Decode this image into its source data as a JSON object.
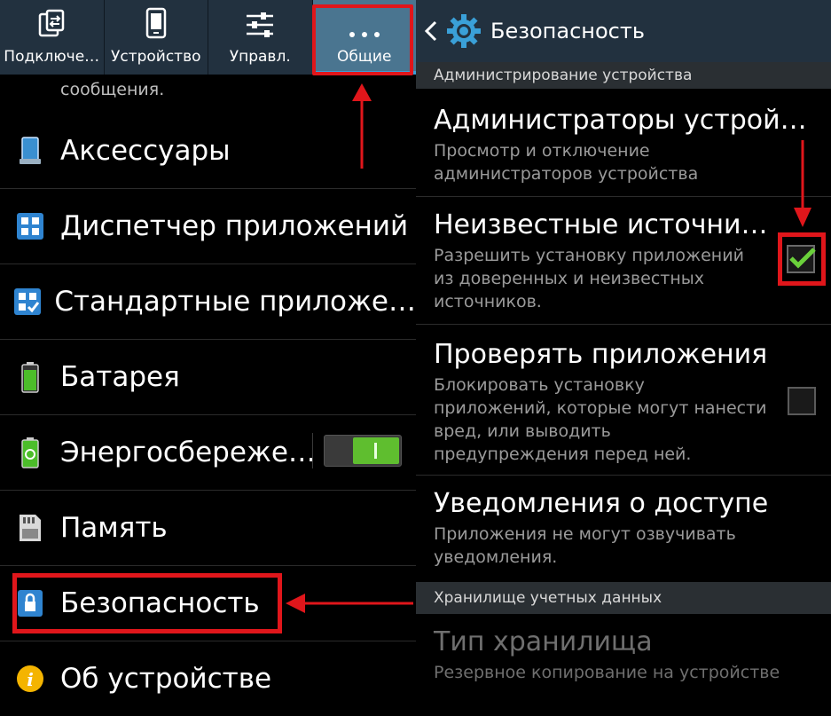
{
  "left": {
    "tabs": [
      {
        "label": "Подключе…",
        "icon": "connections-icon"
      },
      {
        "label": "Устройство",
        "icon": "device-icon"
      },
      {
        "label": "Управл.",
        "icon": "controls-icon"
      },
      {
        "label": "Общие",
        "icon": "more-icon",
        "active": true
      }
    ],
    "partial_text": "сообщения.",
    "items": [
      {
        "label": "Аксессуары",
        "icon": "accessories-icon"
      },
      {
        "label": "Диспетчер приложений",
        "icon": "app-manager-icon"
      },
      {
        "label": "Стандартные приложе…",
        "icon": "default-apps-icon"
      },
      {
        "label": "Батарея",
        "icon": "battery-icon"
      },
      {
        "label": "Энергосбереже…",
        "icon": "power-saving-icon",
        "toggle": true
      },
      {
        "label": "Память",
        "icon": "storage-icon"
      },
      {
        "label": "Безопасность",
        "icon": "security-lock-icon",
        "highlighted": true
      },
      {
        "label": "Об устройстве",
        "icon": "info-icon"
      }
    ]
  },
  "right": {
    "header_title": "Безопасность",
    "section1": "Администрирование устройства",
    "items": [
      {
        "title": "Администраторы устрой…",
        "subtitle_lines": [
          "Просмотр и отключение",
          "администраторов устройства"
        ]
      },
      {
        "title": "Неизвестные источни…",
        "subtitle_lines": [
          "Разрешить установку приложений",
          "из доверенных и неизвестных",
          "источников."
        ],
        "checked": true
      },
      {
        "title": "Проверять приложения",
        "subtitle_lines": [
          "Блокировать установку",
          "приложений, которые могут нанести",
          "вред, или выводить",
          "предупреждения перед ней."
        ],
        "checked": false
      },
      {
        "title": "Уведомления о доступе",
        "subtitle_lines": [
          "Приложения не могут озвучивать",
          "уведомления."
        ]
      }
    ],
    "section2": "Хранилище учетных данных",
    "storage": {
      "title": "Тип хранилища",
      "subtitle": "Резервное копирование на устройстве"
    }
  },
  "colors": {
    "highlight": "#e0161b",
    "accent": "#3aa0d8",
    "toggle_on": "#5fbe2f"
  }
}
